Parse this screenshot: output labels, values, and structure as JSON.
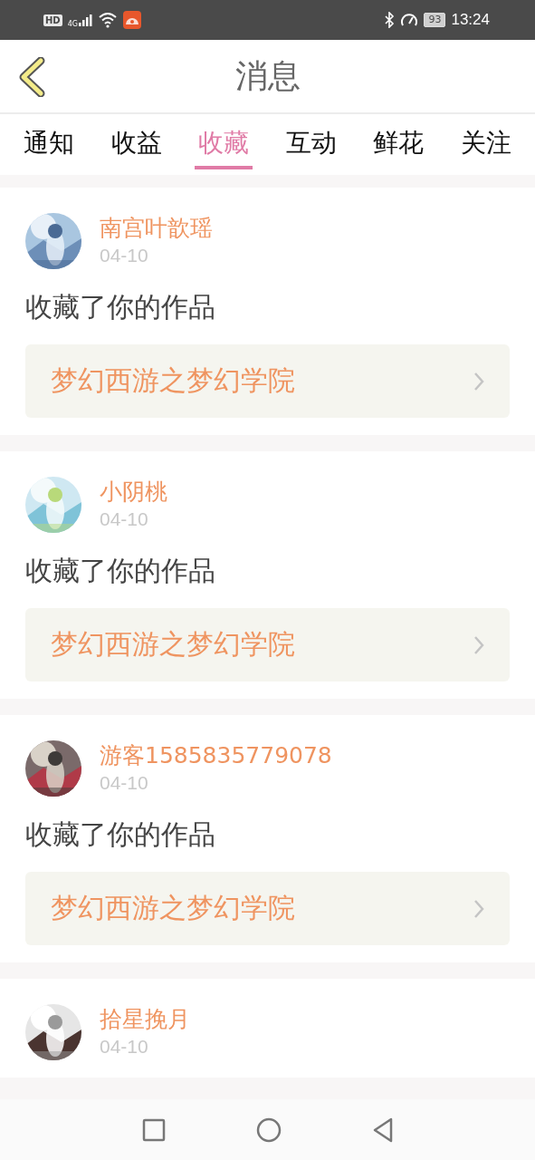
{
  "status_bar": {
    "hd": "HD",
    "network": "4G",
    "battery": "93",
    "time": "13:24"
  },
  "header": {
    "title": "消息"
  },
  "tabs": [
    {
      "label": "通知",
      "selected": false
    },
    {
      "label": "收益",
      "selected": false
    },
    {
      "label": "收藏",
      "selected": true
    },
    {
      "label": "互动",
      "selected": false
    },
    {
      "label": "鲜花",
      "selected": false
    },
    {
      "label": "关注",
      "selected": false
    }
  ],
  "messages": [
    {
      "name": "南宫叶歆瑶",
      "date": "04-10",
      "action": "收藏了你的作品",
      "work": "梦幻西游之梦幻学院"
    },
    {
      "name": "小阴桃",
      "date": "04-10",
      "action": "收藏了你的作品",
      "work": "梦幻西游之梦幻学院"
    },
    {
      "name": "游客1585835779078",
      "date": "04-10",
      "action": "收藏了你的作品",
      "work": "梦幻西游之梦幻学院"
    },
    {
      "name": "拾星挽月",
      "date": "04-10"
    }
  ]
}
